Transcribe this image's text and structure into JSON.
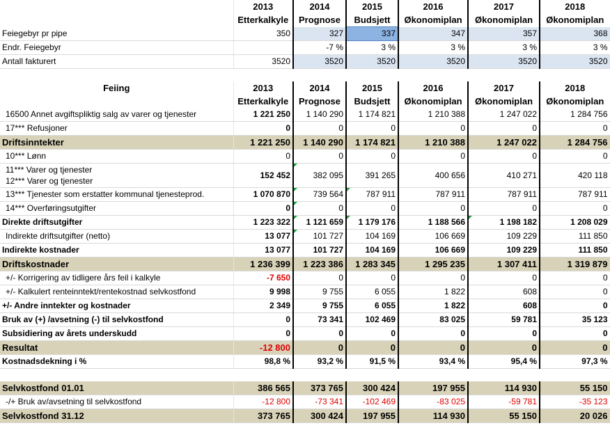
{
  "top": {
    "header": {
      "years": [
        "2013",
        "2014",
        "2015",
        "2016",
        "2017",
        "2018"
      ],
      "subs": [
        "Etterkalkyle",
        "Prognose",
        "Budsjett",
        "Økonomiplan",
        "Økonomiplan",
        "Økonomiplan"
      ]
    },
    "rows": [
      {
        "label": "Feiegebyr pr pipe",
        "values": [
          "350",
          "327",
          "337",
          "347",
          "357",
          "368"
        ]
      },
      {
        "label": "Endr. Feiegebyr",
        "values": [
          "",
          "-7 %",
          "3 %",
          "3 %",
          "3 %",
          "3 %"
        ]
      },
      {
        "label": "Antall fakturert",
        "values": [
          "3520",
          "3520",
          "3520",
          "3520",
          "3520",
          "3520"
        ]
      }
    ]
  },
  "main": {
    "title": "Feiing",
    "years": [
      "2013",
      "2014",
      "2015",
      "2016",
      "2017",
      "2018"
    ],
    "subs": [
      "Etterkalkyle",
      "Prognose",
      "Budsjett",
      "Økonomiplan",
      "Økonomiplan",
      "Økonomiplan"
    ],
    "rows": [
      {
        "label": "16500 Annet avgiftspliktig salg av varer og tjenester",
        "values": [
          "1 221 250",
          "1 140 290",
          "1 174 821",
          "1 210 388",
          "1 247 022",
          "1 284 756"
        ]
      },
      {
        "label": "17*** Refusjoner",
        "values": [
          "0",
          "0",
          "0",
          "0",
          "0",
          "0"
        ]
      },
      {
        "label": "Driftsinntekter",
        "values": [
          "1 221 250",
          "1 140 290",
          "1 174 821",
          "1 210 388",
          "1 247 022",
          "1 284 756"
        ]
      },
      {
        "label": "10*** Lønn",
        "values": [
          "0",
          "0",
          "0",
          "0",
          "0",
          "0"
        ]
      },
      {
        "label": "11*** Varer og tjenester",
        "label2": "12*** Varer og tjenester",
        "values": [
          "152 452",
          "382 095",
          "391 265",
          "400 656",
          "410 271",
          "420 118"
        ]
      },
      {
        "label": "13*** Tjenester som erstatter kommunal tjenesteprod.",
        "values": [
          "1 070 870",
          "739 564",
          "787 911",
          "787 911",
          "787 911",
          "787 911"
        ]
      },
      {
        "label": "14*** Overføringsutgifter",
        "values": [
          "0",
          "0",
          "0",
          "0",
          "0",
          "0"
        ]
      },
      {
        "label": "Direkte driftsutgifter",
        "values": [
          "1 223 322",
          "1 121 659",
          "1 179 176",
          "1 188 566",
          "1 198 182",
          "1 208 029"
        ]
      },
      {
        "label": "Indirekte driftsutgifter (netto)",
        "values": [
          "13 077",
          "101 727",
          "104 169",
          "106 669",
          "109 229",
          "111 850"
        ]
      },
      {
        "label": "Indirekte kostnader",
        "values": [
          "13 077",
          "101 727",
          "104 169",
          "106 669",
          "109 229",
          "111 850"
        ]
      },
      {
        "label": "Driftskostnader",
        "values": [
          "1 236 399",
          "1 223 386",
          "1 283 345",
          "1 295 235",
          "1 307 411",
          "1 319 879"
        ]
      },
      {
        "label": "+/- Korrigering av tidligere års feil i kalkyle",
        "values": [
          "-7 650",
          "0",
          "0",
          "0",
          "0",
          "0"
        ]
      },
      {
        "label": "+/- Kalkulert renteinntekt/rentekostnad selvkostfond",
        "values": [
          "9 998",
          "9 755",
          "6 055",
          "1 822",
          "608",
          "0"
        ]
      },
      {
        "label": "+/- Andre inntekter og kostnader",
        "values": [
          "2 349",
          "9 755",
          "6 055",
          "1 822",
          "608",
          "0"
        ]
      },
      {
        "label": "Bruk av (+) /avsetning (-) til selvkostfond",
        "values": [
          "0",
          "73 341",
          "102 469",
          "83 025",
          "59 781",
          "35 123"
        ]
      },
      {
        "label": "Subsidiering av årets underskudd",
        "values": [
          "0",
          "0",
          "0",
          "0",
          "0",
          "0"
        ]
      },
      {
        "label": "Resultat",
        "values": [
          "-12 800",
          "0",
          "0",
          "0",
          "0",
          "0"
        ]
      },
      {
        "label": "Kostnadsdekning i %",
        "values": [
          "98,8 %",
          "93,2 %",
          "91,5 %",
          "93,4 %",
          "95,4 %",
          "97,3 %"
        ]
      },
      {
        "label": "Selvkostfond 01.01",
        "values": [
          "386 565",
          "373 765",
          "300 424",
          "197 955",
          "114 930",
          "55 150"
        ]
      },
      {
        "label": "-/+ Bruk av/avsetning til selvkostfond",
        "values": [
          "-12 800",
          "-73 341",
          "-102 469",
          "-83 025",
          "-59 781",
          "-35 123"
        ]
      },
      {
        "label": "Selvkostfond 31.12",
        "values": [
          "373 765",
          "300 424",
          "197 955",
          "114 930",
          "55 150",
          "20 026"
        ]
      }
    ]
  },
  "colors": {
    "band": "#d8d3b8",
    "blue_fill": "#dbe5f1",
    "selected_fill": "#8db3e2",
    "negative": "#e00000"
  }
}
